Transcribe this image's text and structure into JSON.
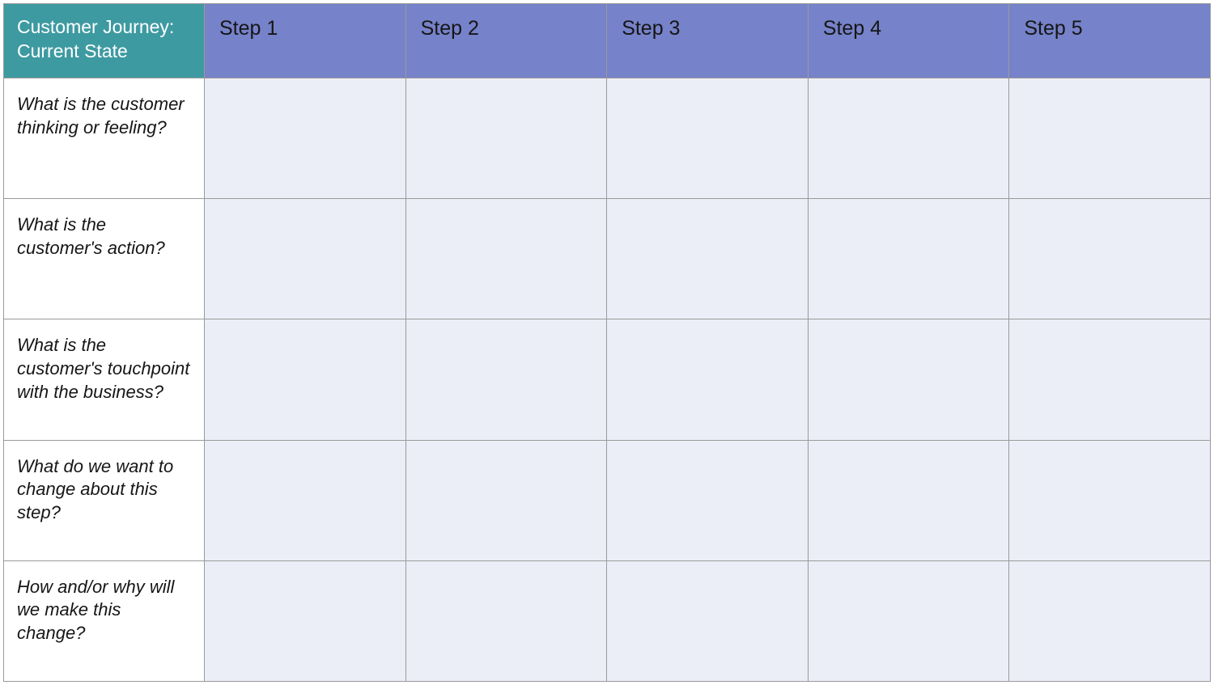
{
  "table": {
    "title": "Customer Journey: Current State",
    "columns": [
      {
        "label": "Step 1"
      },
      {
        "label": "Step 2"
      },
      {
        "label": "Step 3"
      },
      {
        "label": "Step 4"
      },
      {
        "label": "Step 5"
      }
    ],
    "rows": [
      {
        "label": "What is the customer thinking or feeling?",
        "cells": [
          "",
          "",
          "",
          "",
          ""
        ]
      },
      {
        "label": "What is the customer's action?",
        "cells": [
          "",
          "",
          "",
          "",
          ""
        ]
      },
      {
        "label": "What is the customer's touchpoint with the business?",
        "cells": [
          "",
          "",
          "",
          "",
          ""
        ]
      },
      {
        "label": "What do we want to change about this step?",
        "cells": [
          "",
          "",
          "",
          "",
          ""
        ]
      },
      {
        "label": "How and/or why will we make this change?",
        "cells": [
          "",
          "",
          "",
          "",
          ""
        ]
      }
    ]
  }
}
